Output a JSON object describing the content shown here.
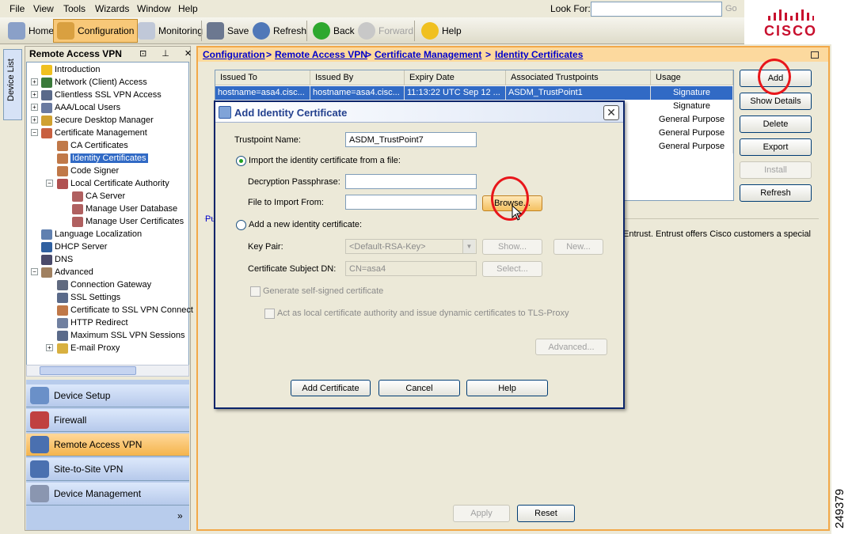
{
  "menu": [
    "File",
    "View",
    "Tools",
    "Wizards",
    "Window",
    "Help"
  ],
  "lookfor": {
    "label": "Look For:",
    "value": "",
    "go": "Go"
  },
  "toolbar": {
    "home": "Home",
    "configuration": "Configuration",
    "monitoring": "Monitoring",
    "save": "Save",
    "refresh": "Refresh",
    "back": "Back",
    "forward": "Forward",
    "help": "Help"
  },
  "brand": {
    "name": "CISCO",
    "color": "#c8102e"
  },
  "device_list_tab": "Device List",
  "left_panel": {
    "title": "Remote Access VPN",
    "controls": "⊡ ⊥ ✕",
    "tree": [
      {
        "label": "Introduction",
        "icon": "question-icon"
      },
      {
        "label": "Network (Client) Access",
        "icon": "network-icon"
      },
      {
        "label": "Clientless SSL VPN Access",
        "icon": "ssl-icon"
      },
      {
        "label": "AAA/Local Users",
        "icon": "users-icon"
      },
      {
        "label": "Secure Desktop Manager",
        "icon": "lock-icon"
      },
      {
        "label": "Certificate Management",
        "icon": "cert-icon"
      },
      {
        "label": "CA Certificates",
        "icon": "cert-icon"
      },
      {
        "label": "Identity Certificates",
        "icon": "cert-icon"
      },
      {
        "label": "Code Signer",
        "icon": "cert-icon"
      },
      {
        "label": "Local Certificate Authority",
        "icon": "cert-icon"
      },
      {
        "label": "CA Server",
        "icon": "server-icon"
      },
      {
        "label": "Manage User Database",
        "icon": "database-icon"
      },
      {
        "label": "Manage User Certificates",
        "icon": "cert-icon"
      },
      {
        "label": "Language Localization",
        "icon": "globe-icon"
      },
      {
        "label": "DHCP Server",
        "icon": "dhcp-icon"
      },
      {
        "label": "DNS",
        "icon": "dns-icon"
      },
      {
        "label": "Advanced",
        "icon": "advanced-icon"
      },
      {
        "label": "Connection Gateway",
        "icon": "gateway-icon"
      },
      {
        "label": "SSL Settings",
        "icon": "ssl-icon"
      },
      {
        "label": "Certificate to SSL VPN Connect",
        "icon": "cert-icon"
      },
      {
        "label": "HTTP Redirect",
        "icon": "url-icon"
      },
      {
        "label": "Maximum SSL VPN Sessions",
        "icon": "sessions-icon"
      },
      {
        "label": "E-mail Proxy",
        "icon": "email-icon"
      }
    ]
  },
  "nav": {
    "device_setup": "Device Setup",
    "firewall": "Firewall",
    "remote_access_vpn": "Remote Access VPN",
    "site_to_site_vpn": "Site-to-Site VPN",
    "device_management": "Device Management",
    "more": "»"
  },
  "breadcrumb": {
    "configuration": "Configuration",
    "remote_access_vpn": "Remote Access VPN",
    "certificate_management": "Certificate Management",
    "identity_certificates": "Identity Certificates",
    "sep": ">"
  },
  "table": {
    "headers": [
      "Issued To",
      "Issued By",
      "Expiry Date",
      "Associated Trustpoints",
      "Usage"
    ],
    "rows": [
      [
        "hostname=asa4.cisc...",
        "hostname=asa4.cisc...",
        "11:13:22 UTC Sep 12 ...",
        "ASDM_TrustPoint1",
        "Signature"
      ],
      [
        "",
        "",
        "",
        "",
        "Signature"
      ],
      [
        "",
        "",
        "",
        "",
        "General Purpose"
      ],
      [
        "",
        "",
        "",
        "",
        "General Purpose"
      ],
      [
        "",
        "",
        "",
        "",
        "General Purpose"
      ]
    ]
  },
  "actions": {
    "add": "Add",
    "show_details": "Show Details",
    "delete": "Delete",
    "export": "Export",
    "install": "Install",
    "refresh": "Refresh"
  },
  "main_text": {
    "pu": "Pu",
    "entrust": "Entrust. Entrust offers Cisco customers a special"
  },
  "bottom": {
    "apply": "Apply",
    "reset": "Reset"
  },
  "dialog": {
    "title": "Add Identity Certificate",
    "close": "✕",
    "trustpoint_label": "Trustpoint Name:",
    "trustpoint_value": "ASDM_TrustPoint7",
    "import_radio": "Import the identity certificate from a file:",
    "passphrase_label": "Decryption Passphrase:",
    "passphrase_value": "",
    "file_label": "File to Import From:",
    "file_value": "",
    "browse": "Browse...",
    "add_new_radio": "Add a new identity certificate:",
    "keypair_label": "Key Pair:",
    "keypair_value": "<Default-RSA-Key>",
    "show_btn": "Show...",
    "new_btn": "New...",
    "subject_label": "Certificate Subject DN:",
    "subject_value": "CN=asa4",
    "select_btn": "Select...",
    "self_signed": "Generate self-signed certificate",
    "act_as_ca": "Act as local certificate authority and issue dynamic certificates to TLS-Proxy",
    "advanced_btn": "Advanced...",
    "add_cert_btn": "Add Certificate",
    "cancel_btn": "Cancel",
    "help_btn": "Help"
  },
  "figure_id": "249379"
}
